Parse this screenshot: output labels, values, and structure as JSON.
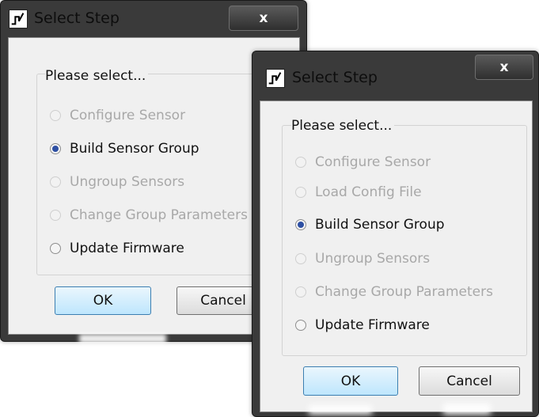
{
  "dialogs": [
    {
      "title": "Select Step",
      "close_label": "x",
      "group_title": "Please select...",
      "options": [
        {
          "label": "Configure Sensor",
          "enabled": false,
          "checked": false
        },
        {
          "label": "Build Sensor Group",
          "enabled": true,
          "checked": true
        },
        {
          "label": "Ungroup Sensors",
          "enabled": false,
          "checked": false
        },
        {
          "label": "Change Group Parameters",
          "enabled": false,
          "checked": false
        },
        {
          "label": "Update Firmware",
          "enabled": true,
          "checked": false
        }
      ],
      "ok_label": "OK",
      "cancel_label": "Cancel"
    },
    {
      "title": "Select Step",
      "close_label": "x",
      "group_title": "Please select...",
      "options": [
        {
          "label": "Configure Sensor",
          "enabled": false,
          "checked": false
        },
        {
          "label": "Load Config File",
          "enabled": false,
          "checked": false
        },
        {
          "label": "Build Sensor Group",
          "enabled": true,
          "checked": true
        },
        {
          "label": "Ungroup Sensors",
          "enabled": false,
          "checked": false
        },
        {
          "label": "Change Group Parameters",
          "enabled": false,
          "checked": false
        },
        {
          "label": "Update Firmware",
          "enabled": true,
          "checked": false
        }
      ],
      "ok_label": "OK",
      "cancel_label": "Cancel"
    }
  ],
  "colors": {
    "radio_checked": "#2d4fa3",
    "disabled_text": "#a8a8a8",
    "frame_dark": "#3a3a3a"
  }
}
